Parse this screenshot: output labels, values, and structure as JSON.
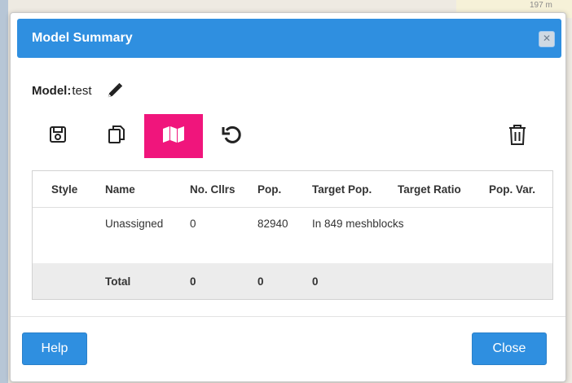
{
  "map": {
    "scale_label": "197 m"
  },
  "dialog": {
    "title": "Model Summary",
    "close_glyph": "✕"
  },
  "model": {
    "label": "Model:",
    "name": "test"
  },
  "toolbar": {
    "icons": [
      "save-icon",
      "copy-icon",
      "map-icon",
      "undo-icon",
      "trash-icon"
    ],
    "active": "map-icon",
    "active_color": "#f0157c"
  },
  "table": {
    "headers": [
      "Style",
      "Name",
      "No. Cllrs",
      "Pop.",
      "Target Pop.",
      "Target Ratio",
      "Pop. Var."
    ],
    "rows": [
      {
        "style": "",
        "name": "Unassigned",
        "cllrs": "0",
        "pop": "82940",
        "target_pop": "In 849 meshblocks",
        "target_ratio": "",
        "pop_var": ""
      }
    ],
    "total": {
      "style": "",
      "name": "Total",
      "cllrs": "0",
      "pop": "0",
      "target_pop": "0",
      "target_ratio": "",
      "pop_var": ""
    }
  },
  "footer": {
    "help_label": "Help",
    "close_label": "Close"
  },
  "colors": {
    "header_bg": "#2f8fe0",
    "button_bg": "#2f8fe0",
    "total_row_bg": "#ececec"
  }
}
